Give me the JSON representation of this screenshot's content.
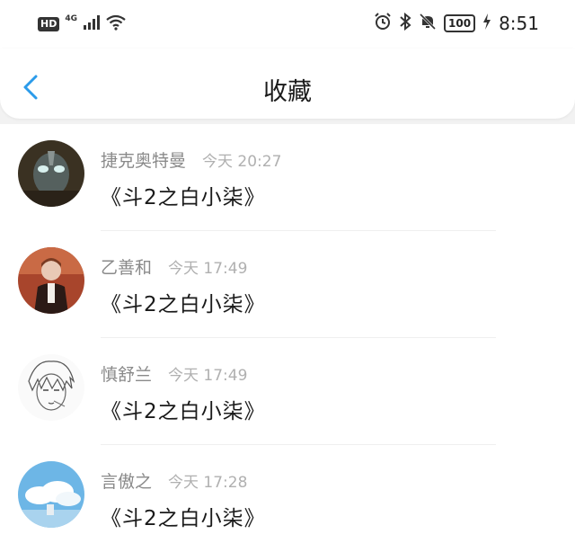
{
  "status_bar": {
    "hd": "HD",
    "network": "4G",
    "battery": "100",
    "time": "8:51",
    "icons": [
      "signal-icon",
      "wifi-icon",
      "alarm-icon",
      "bluetooth-icon",
      "mute-icon",
      "charging-icon"
    ]
  },
  "header": {
    "back_icon": "chevron-left-icon",
    "title": "收藏"
  },
  "colors": {
    "accent": "#2b9bea",
    "text_primary": "#1a1a1a",
    "text_secondary": "#8a8a8a",
    "text_tertiary": "#b0b0b0"
  },
  "favorites": [
    {
      "name": "捷克奥特曼",
      "time": "今天 20:27",
      "title": "《斗2之白小柒》",
      "avatar_icon": "avatar-ultraman"
    },
    {
      "name": "乙善和",
      "time": "今天 17:49",
      "title": "《斗2之白小柒》",
      "avatar_icon": "avatar-portrait-red"
    },
    {
      "name": "慎舒兰",
      "time": "今天 17:49",
      "title": "《斗2之白小柒》",
      "avatar_icon": "avatar-sketch"
    },
    {
      "name": "言傲之",
      "time": "今天 17:28",
      "title": "《斗2之白小柒》",
      "avatar_icon": "avatar-sky-clouds"
    }
  ]
}
